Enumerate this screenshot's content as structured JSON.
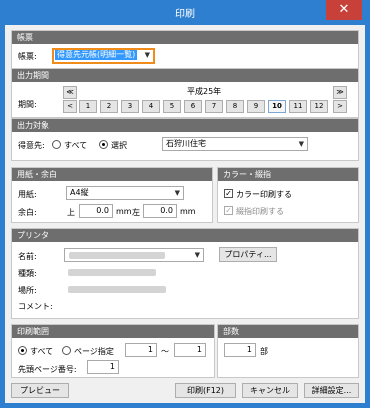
{
  "window": {
    "title": "印刷",
    "close_glyph": "✕"
  },
  "ledger": {
    "header": "帳票",
    "label": "帳票:",
    "value": "得意先元帳(明細一覧)"
  },
  "period": {
    "header": "出力期間",
    "label": "期間:",
    "year": "平成25年",
    "months": [
      "1",
      "2",
      "3",
      "4",
      "5",
      "6",
      "7",
      "8",
      "9",
      "10",
      "11",
      "12"
    ],
    "selected_month": "10",
    "first_glyph": "≪",
    "prev_glyph": "<",
    "next_glyph": ">",
    "last_glyph": "≫"
  },
  "target": {
    "header": "出力対象",
    "label": "得意先:",
    "option_all": "すべて",
    "option_select": "選択",
    "selected_option": "選択",
    "customer": "石狩川住宅"
  },
  "paper": {
    "header": "用紙・余白",
    "size_label": "用紙:",
    "size_value": "A4縦",
    "margin_label": "余白:",
    "top_label": "上",
    "top_value": "0.0",
    "left_label": "左",
    "left_value": "0.0",
    "unit": "mm"
  },
  "color": {
    "header": "カラー・綴指",
    "color_print": "カラー印刷する",
    "color_checked": true,
    "binding_print": "綴指印刷する",
    "binding_checked": true,
    "binding_enabled": false
  },
  "printer": {
    "header": "プリンタ",
    "name_label": "名前:",
    "type_label": "種類:",
    "location_label": "場所:",
    "comment_label": "コメント:",
    "properties_button": "プロパティ..."
  },
  "range": {
    "header": "印刷範囲",
    "option_all": "すべて",
    "option_pages": "ページ指定",
    "selected_option": "すべて",
    "from": "1",
    "separator": "〜",
    "to": "1",
    "start_page_label": "先頭ページ番号:",
    "start_page": "1"
  },
  "copies": {
    "header": "部数",
    "value": "1",
    "unit": "部"
  },
  "buttons": {
    "preview": "プレビュー",
    "print": "印刷(F12)",
    "cancel": "キャンセル",
    "details": "詳細設定..."
  }
}
